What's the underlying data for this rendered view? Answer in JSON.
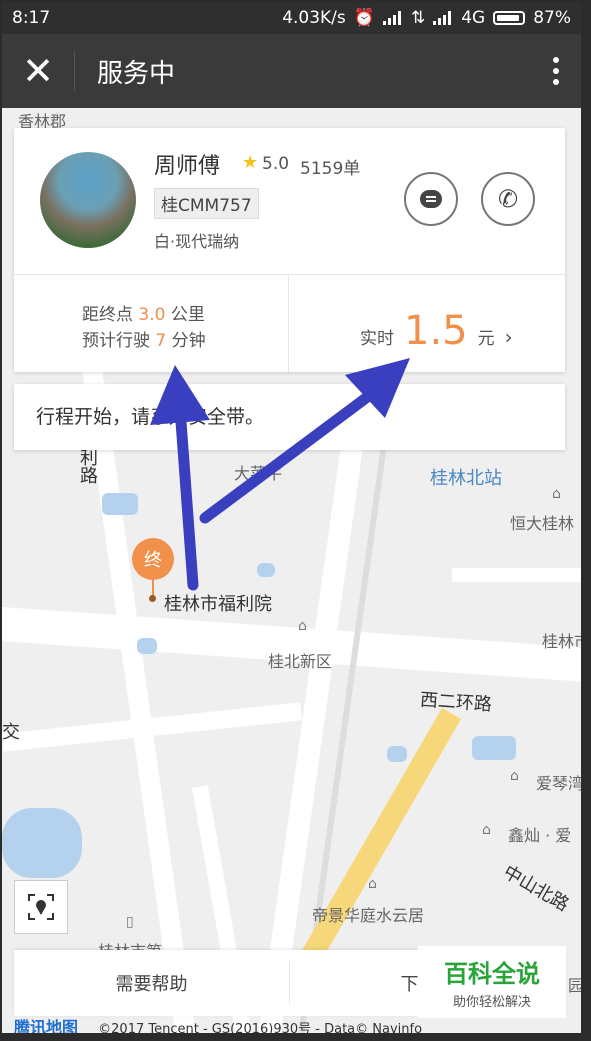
{
  "status_bar": {
    "time": "8:17",
    "speed": "4.03K/s",
    "network": "4G",
    "battery": "87%"
  },
  "titlebar": {
    "title": "服务中"
  },
  "driver": {
    "name": "周师傅",
    "rating": "5.0",
    "orders": "5159单",
    "plate": "桂CMM757",
    "car": "白·现代瑞纳"
  },
  "trip": {
    "dist_prefix": "距终点",
    "dist_value": "3.0",
    "dist_unit": "公里",
    "eta_prefix": "预计行驶",
    "eta_value": "7",
    "eta_unit": "分钟",
    "fare_label": "实时",
    "fare_value": "1.5",
    "fare_unit": "元"
  },
  "notice": {
    "text": "行程开始，请系好安全带。"
  },
  "map": {
    "destination_pin": "终",
    "labels": {
      "xianglin": "香林郡",
      "lilu": "利路",
      "dashe": "大菜牛",
      "guilin_north_station": "桂林北站",
      "hengda": "恒大桂林",
      "fuliyuan": "桂林市福利院",
      "guibei": "桂北新区",
      "guilin_right": "桂林市",
      "xierhuan": "西二环路",
      "jiao": "交",
      "aiqin": "爱琴湾",
      "xinshan": "鑫灿 · 爱",
      "zhongshan": "中山北路",
      "dijing": "帝景华庭水云居",
      "guilin_bottom": "桂林市第",
      "yuan": "园"
    }
  },
  "bottom": {
    "help": "需要帮助",
    "download": "下载滴"
  },
  "copyright": {
    "logo": "腾讯地图",
    "text": "©2017 Tencent - GS(2016)930号 - Data© Navinfo"
  },
  "watermark": {
    "title": "百科全说",
    "subtitle": "助你轻松解决"
  },
  "colors": {
    "accent": "#f0904a",
    "arrow": "#3a3fc0",
    "titlebar": "#3a3a3a"
  }
}
